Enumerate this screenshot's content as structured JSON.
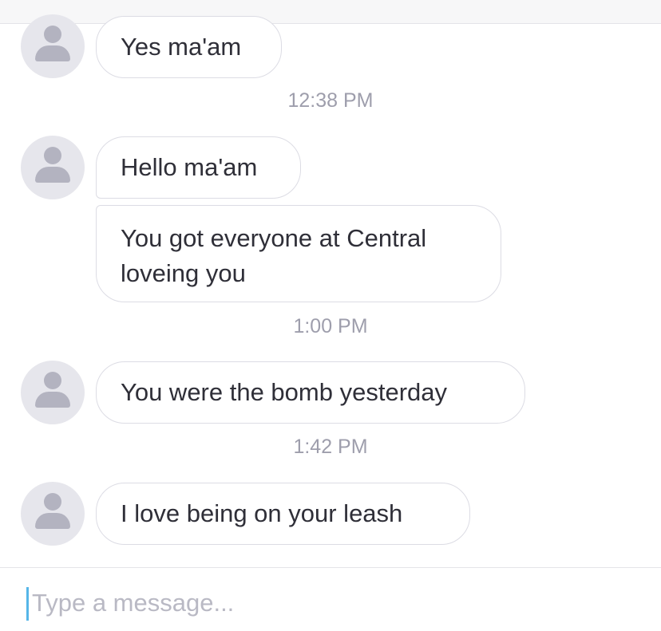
{
  "messages": [
    {
      "text": "Yes ma'am"
    },
    {
      "text": "Hello ma'am"
    },
    {
      "text": "You got everyone at Central loveing you"
    },
    {
      "text": "You were the bomb yesterday"
    },
    {
      "text": "I love being on your leash"
    }
  ],
  "timestamps": [
    "12:38 PM",
    "1:00 PM",
    "1:42 PM"
  ],
  "composer": {
    "placeholder": "Type a message..."
  },
  "colors": {
    "bubble_border": "#dcdce4",
    "timestamp": "#9e9eac",
    "avatar_bg": "#e6e6ec",
    "caret": "#56b6e8"
  }
}
